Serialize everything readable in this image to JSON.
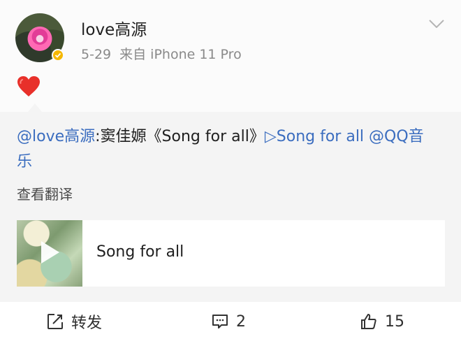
{
  "post": {
    "username": "love高源",
    "date": "5-29",
    "source": "来自 iPhone 11 Pro",
    "emoji": "heart-icon"
  },
  "repost": {
    "mention": "@love高源",
    "text_part": ":窦佳嫄《Song for all》",
    "music_link": "▷Song for all @QQ音乐",
    "translate_label": "查看翻译"
  },
  "card": {
    "title": "Song for all"
  },
  "actions": {
    "share_label": "转发",
    "comment_count": "2",
    "like_count": "15"
  },
  "colors": {
    "link": "#3b6dbf",
    "repost_bg": "#f4f4f4",
    "badge": "#f5b800"
  }
}
